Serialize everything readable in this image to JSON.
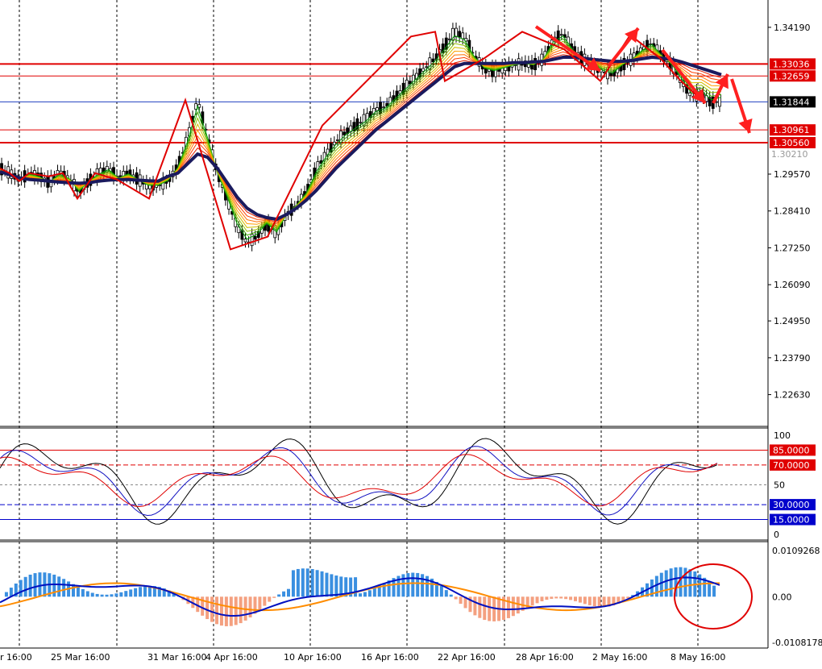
{
  "price_axis": {
    "ticks": [
      "1.34190",
      "1.30210",
      "1.29570",
      "1.28410",
      "1.27250",
      "1.26090",
      "1.24950",
      "1.23790",
      "1.22630"
    ],
    "ymin": 1.2163,
    "ymax": 1.3505
  },
  "levels": [
    {
      "label": "1.33036",
      "value": 1.33036,
      "color": "#e00000",
      "width": 2
    },
    {
      "label": "1.32659",
      "value": 1.32659,
      "color": "#e00000",
      "width": 1
    },
    {
      "label": "1.30961",
      "value": 1.30961,
      "color": "#e00000",
      "width": 1
    },
    {
      "label": "1.30560",
      "value": 1.3056,
      "color": "#e00000",
      "width": 2
    }
  ],
  "current_price": {
    "label": "1.31844",
    "value": 1.31844,
    "color": "#2040c0"
  },
  "x_axis": {
    "labels": [
      "r 16:00",
      "25 Mar 16:00",
      "31 Mar 16:00",
      "4 Apr 16:00",
      "10 Apr 16:00",
      "16 Apr 16:00",
      "22 Apr 16:00",
      "28 Apr 16:00",
      "2 May 16:00",
      "8 May 16:00"
    ]
  },
  "stoch_panel": {
    "axis_ticks": [
      "100",
      "50",
      "0"
    ],
    "levels": [
      {
        "label": "85.0000",
        "value": 85,
        "color": "#e00000"
      },
      {
        "label": "70.0000",
        "value": 70,
        "color": "#e00000"
      },
      {
        "label": "30.0000",
        "value": 30,
        "color": "#0000cc"
      },
      {
        "label": "15.0000",
        "value": 15,
        "color": "#0000cc"
      }
    ]
  },
  "macd_panel": {
    "axis_ticks": [
      "0.0109268",
      "0.00",
      "-0.0108178"
    ],
    "ymax": 0.0109268,
    "ymin": -0.0108178
  },
  "chart_data": {
    "type": "line",
    "series": [
      {
        "values": [
          1.2975,
          1.296,
          1.294,
          1.296,
          1.295,
          1.293,
          1.296,
          1.2945,
          1.29,
          1.2935,
          1.296,
          1.2975,
          1.2945,
          1.296,
          1.294,
          1.292,
          1.292,
          1.2935,
          1.298,
          1.307,
          1.319,
          1.308,
          1.296,
          1.288,
          1.279,
          1.274,
          1.276,
          1.28,
          1.277,
          1.283,
          1.286,
          1.29,
          1.297,
          1.302,
          1.306,
          1.309,
          1.311,
          1.313,
          1.316,
          1.317,
          1.32,
          1.323,
          1.326,
          1.329,
          1.332,
          1.336,
          1.3405,
          1.339,
          1.333,
          1.329,
          1.328,
          1.329,
          1.33,
          1.3305,
          1.33,
          1.332,
          1.338,
          1.34,
          1.335,
          1.332,
          1.33,
          1.328,
          1.327,
          1.33,
          1.332,
          1.335,
          1.337,
          1.333,
          1.33,
          1.325,
          1.32,
          1.321,
          1.318,
          1.319
        ]
      },
      {
        "values": [
          1.2965,
          1.2955,
          1.2945,
          1.294,
          1.2938,
          1.2935,
          1.2932,
          1.293,
          1.2928,
          1.293,
          1.2935,
          1.2938,
          1.294,
          1.294,
          1.2938,
          1.2936,
          1.2935,
          1.295,
          1.296,
          1.299,
          1.302,
          1.301,
          1.2975,
          1.293,
          1.2885,
          1.285,
          1.283,
          1.282,
          1.2815,
          1.283,
          1.285,
          1.2875,
          1.2905,
          1.294,
          1.2975,
          1.3005,
          1.3035,
          1.3065,
          1.3095,
          1.312,
          1.3145,
          1.317,
          1.3195,
          1.322,
          1.3245,
          1.327,
          1.3295,
          1.3305,
          1.3305,
          1.3305,
          1.3305,
          1.3305,
          1.3308,
          1.3308,
          1.331,
          1.3312,
          1.3318,
          1.3325,
          1.3325,
          1.3322,
          1.3318,
          1.3315,
          1.3312,
          1.3312,
          1.3315,
          1.332,
          1.3325,
          1.3322,
          1.3318,
          1.331,
          1.33,
          1.329,
          1.328,
          1.327
        ]
      }
    ]
  }
}
